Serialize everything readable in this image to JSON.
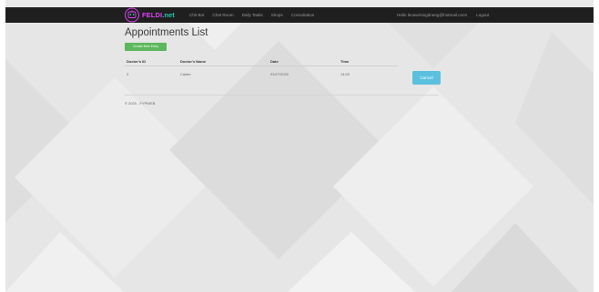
{
  "navbar": {
    "brand_part1": "FELDI",
    "brand_part2": ".net",
    "links": [
      "Chit Bot",
      "Chat Room",
      "Daily Tasks",
      "Shops",
      "Consultation"
    ],
    "user_greeting": "Hello lenawmingdneng@hotmail.com!",
    "logout_label": "Logout"
  },
  "page": {
    "title": "Appointments List",
    "create_button_label": "Create New Entry"
  },
  "table": {
    "columns": [
      "Doctor's ID",
      "Doctor's Name",
      "Date",
      "Time"
    ],
    "rows": [
      {
        "doctor_id": "3",
        "doctor_name": "Calder",
        "date": "03/27/2020",
        "time": "14:00",
        "action_label": "Cancel"
      }
    ]
  },
  "footer": {
    "text": "© 2020 - FYPWEB"
  },
  "colors": {
    "navbar_bg": "#1f1f1f",
    "brand_pink": "#e040fb",
    "brand_teal": "#27c9a8",
    "create_button": "#5cb85c",
    "cancel_button": "#5bc0de"
  }
}
